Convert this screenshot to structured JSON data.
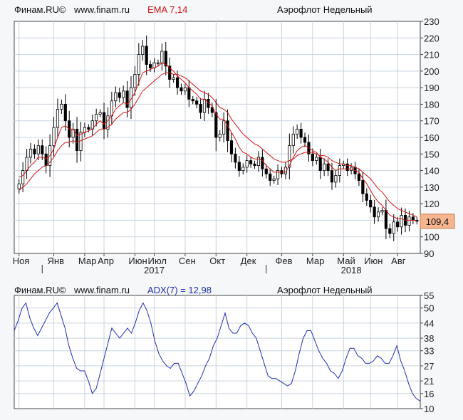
{
  "chart_data": [
    {
      "type": "candlestick",
      "source_label": "Финам.RU©",
      "site": "www.finam.ru",
      "indicator_label": "EMA 7,14",
      "instrument_label": "Аэрофлот Недельный",
      "last_price_label": "109,4",
      "last_price": 109.4,
      "ylim": [
        90,
        230
      ],
      "y_ticks": [
        90,
        100,
        110,
        120,
        130,
        140,
        150,
        160,
        170,
        180,
        190,
        200,
        210,
        220,
        230
      ],
      "month_labels": [
        {
          "label": "Ноя",
          "index": 0
        },
        {
          "label": "Янв",
          "index": 9
        },
        {
          "label": "Мар",
          "index": 17
        },
        {
          "label": "Апр",
          "index": 22
        },
        {
          "label": "Июн",
          "index": 30
        },
        {
          "label": "Июл",
          "index": 35
        },
        {
          "label": "Сен",
          "index": 43
        },
        {
          "label": "Окт",
          "index": 51
        },
        {
          "label": "Дек",
          "index": 59
        },
        {
          "label": "Фев",
          "index": 68
        },
        {
          "label": "Мар",
          "index": 76
        },
        {
          "label": "Май",
          "index": 84
        },
        {
          "label": "Июн",
          "index": 91
        },
        {
          "label": "Авг",
          "index": 98
        }
      ],
      "year_labels": [
        {
          "label": "2017",
          "index": 35
        },
        {
          "label": "2018",
          "index": 86
        }
      ],
      "year_markers": [
        6,
        64
      ],
      "colors": {
        "up": "#ffffff",
        "down": "#000000",
        "ema": "#d21414"
      },
      "close": [
        132,
        140,
        148,
        153,
        150,
        155,
        150,
        143,
        155,
        166,
        177,
        180,
        170,
        160,
        165,
        152,
        163,
        166,
        165,
        170,
        174,
        175,
        165,
        173,
        182,
        187,
        184,
        188,
        178,
        190,
        198,
        210,
        215,
        204,
        202,
        205,
        205,
        212,
        203,
        195,
        196,
        190,
        188,
        190,
        183,
        182,
        180,
        175,
        183,
        178,
        175,
        160,
        162,
        170,
        158,
        150,
        145,
        140,
        142,
        146,
        144,
        143,
        148,
        141,
        138,
        134,
        135,
        140,
        138,
        142,
        155,
        162,
        165,
        160,
        157,
        150,
        146,
        148,
        140,
        144,
        140,
        133,
        137,
        143,
        144,
        140,
        142,
        138,
        134,
        126,
        122,
        118,
        112,
        115,
        116,
        105,
        102,
        109,
        106,
        113,
        107,
        112,
        110,
        109.4
      ],
      "ema_fast": [
        136,
        137,
        140,
        143,
        145,
        148,
        148,
        147,
        149,
        153,
        160,
        166,
        167,
        165,
        165,
        161,
        162,
        163,
        164,
        165,
        168,
        170,
        168,
        170,
        173,
        177,
        179,
        181,
        180,
        183,
        187,
        193,
        199,
        200,
        201,
        202,
        203,
        205,
        204,
        202,
        200,
        197,
        195,
        193,
        190,
        188,
        186,
        183,
        183,
        181,
        179,
        174,
        171,
        171,
        167,
        163,
        159,
        154,
        151,
        150,
        148,
        147,
        147,
        146,
        143,
        141,
        139,
        139,
        139,
        139,
        143,
        148,
        152,
        154,
        155,
        154,
        152,
        151,
        148,
        147,
        145,
        142,
        140,
        141,
        141,
        141,
        141,
        140,
        139,
        135,
        132,
        128,
        124,
        121,
        119,
        116,
        113,
        112,
        111,
        111,
        110,
        110,
        110,
        109.8
      ],
      "ema_slow": [
        128,
        130,
        132,
        135,
        138,
        140,
        142,
        143,
        145,
        148,
        152,
        155,
        157,
        157,
        158,
        157,
        158,
        159,
        160,
        161,
        163,
        165,
        165,
        166,
        168,
        171,
        173,
        175,
        175,
        177,
        180,
        184,
        188,
        190,
        192,
        194,
        196,
        198,
        199,
        199,
        198,
        198,
        197,
        196,
        194,
        192,
        190,
        188,
        187,
        186,
        184,
        181,
        178,
        177,
        175,
        171,
        168,
        165,
        162,
        160,
        158,
        156,
        155,
        153,
        151,
        149,
        147,
        146,
        145,
        145,
        146,
        147,
        149,
        150,
        151,
        151,
        151,
        150,
        149,
        149,
        148,
        146,
        145,
        144,
        144,
        143,
        143,
        142,
        141,
        139,
        137,
        135,
        132,
        129,
        127,
        124,
        121,
        119,
        117,
        116,
        115,
        114,
        113,
        112
      ]
    },
    {
      "type": "line",
      "source_label": "Финам.RU©",
      "site": "www.finam.ru",
      "indicator_label": "ADX(7) = 12,98",
      "instrument_label": "Аэрофлот Недельный",
      "ylim": [
        10,
        55
      ],
      "y_ticks": [
        10,
        16,
        21,
        27,
        33,
        38,
        44,
        50,
        55
      ],
      "color": "#1f2fb5",
      "values": [
        41,
        45,
        50,
        52,
        46,
        42,
        39,
        42,
        45,
        48,
        50,
        52,
        47,
        42,
        35,
        30,
        26,
        25,
        25,
        21,
        16,
        18,
        24,
        30,
        36,
        42,
        40,
        38,
        40,
        42,
        40,
        44,
        49,
        52,
        49,
        44,
        37,
        32,
        29,
        27,
        26,
        28,
        28,
        24,
        20,
        15,
        17,
        20,
        23,
        27,
        30,
        35,
        38,
        43,
        48,
        42,
        40,
        40,
        43,
        44,
        43,
        40,
        38,
        33,
        28,
        23,
        22,
        22,
        21,
        20,
        19,
        20,
        25,
        32,
        38,
        41,
        41,
        37,
        33,
        30,
        28,
        25,
        24,
        22,
        25,
        30,
        34,
        34,
        31,
        30,
        28,
        28,
        29,
        31,
        30,
        28,
        28,
        31,
        35,
        29,
        25,
        20,
        16,
        14,
        13
      ]
    }
  ]
}
